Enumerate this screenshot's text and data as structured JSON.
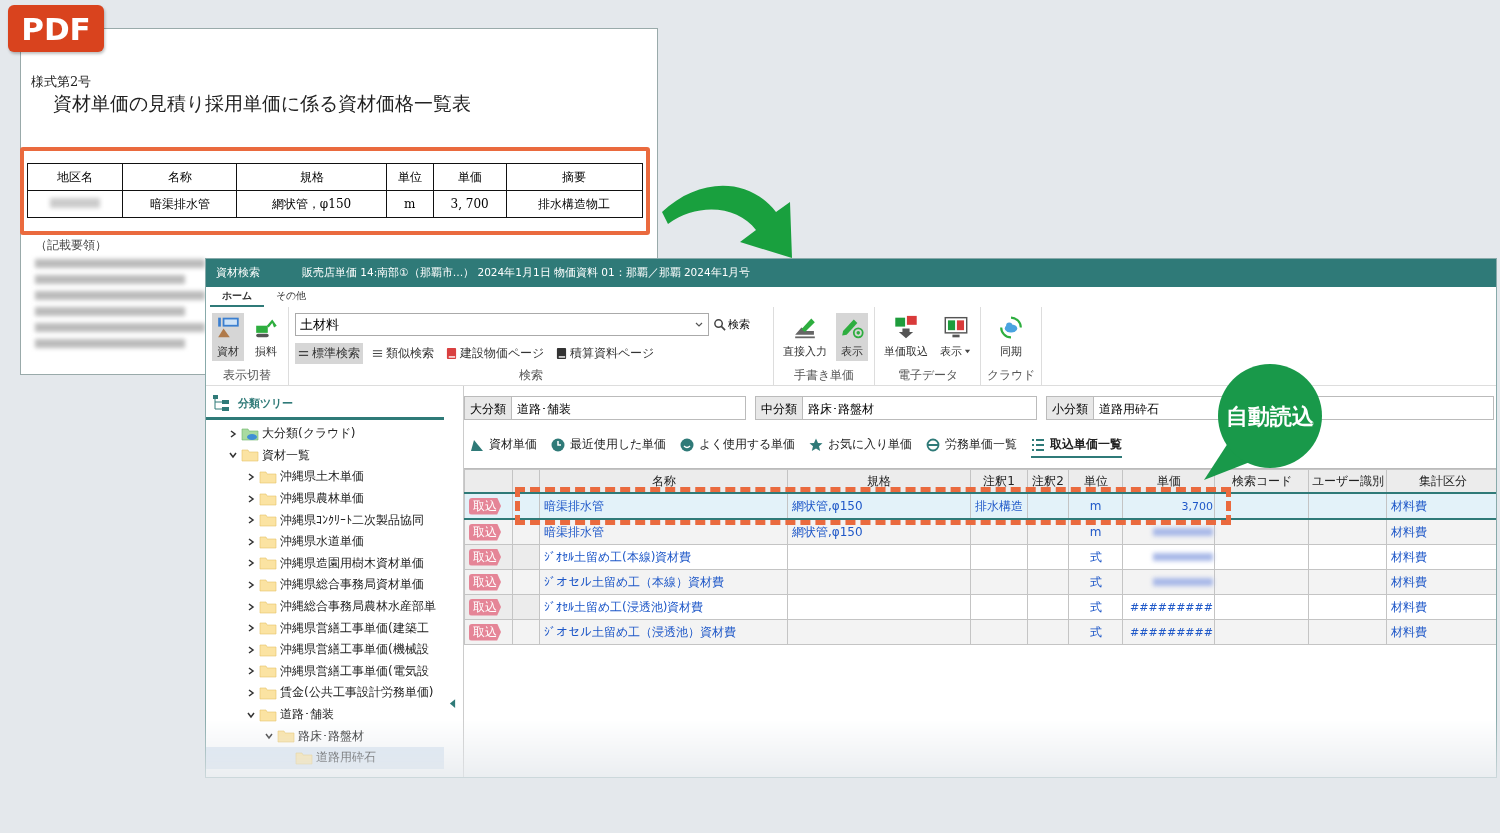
{
  "pdf_badge": "PDF",
  "document": {
    "form_number": "様式第2号",
    "title": "資材単価の見積り採用単価に係る資材価格一覧表",
    "table": {
      "columns": [
        "地区名",
        "名称",
        "規格",
        "単位",
        "単価",
        "摘要"
      ],
      "rows": [
        {
          "name": "暗渠排水管",
          "spec": "網状管，φ150",
          "unit": "m",
          "price": "3, 700",
          "summary": "排水構造物工"
        }
      ]
    },
    "notes_heading": "（記載要領）"
  },
  "app": {
    "title": "資材検索",
    "subtitle": "販売店単価 14:南部①（那覇市…） 2024年1月1日 物価資料 01：那覇／那覇 2024年1月号",
    "tabs": [
      {
        "label": "ホーム",
        "selected": true
      },
      {
        "label": "その他",
        "selected": false
      }
    ],
    "view_group": {
      "label": "表示切替",
      "buttons": [
        {
          "label": "資材",
          "kind": "material",
          "selected": true
        },
        {
          "label": "損料",
          "kind": "excavator",
          "selected": false
        }
      ]
    },
    "search_group": {
      "label": "検索",
      "value": "土材料",
      "button": "検索",
      "options": [
        {
          "label": "標準検索",
          "kind": "equal",
          "selected": true
        },
        {
          "label": "類似検索",
          "kind": "similar",
          "selected": false
        },
        {
          "label": "建設物価ページ",
          "kind": "redbook",
          "selected": false
        },
        {
          "label": "積算資料ページ",
          "kind": "darkbook",
          "selected": false
        }
      ]
    },
    "tool_groups": [
      {
        "label": "手書き単価",
        "buttons": [
          {
            "label": "直接入力",
            "kind": "pen",
            "selected": false,
            "dropdown": false
          },
          {
            "label": "表示",
            "kind": "peneye",
            "selected": true,
            "dropdown": false
          }
        ]
      },
      {
        "label": "電子データ",
        "buttons": [
          {
            "label": "単価取込",
            "kind": "import",
            "selected": false,
            "dropdown": false
          },
          {
            "label": "表示",
            "kind": "monitor",
            "selected": false,
            "dropdown": true
          }
        ]
      },
      {
        "label": "クラウド",
        "buttons": [
          {
            "label": "同期",
            "kind": "sync",
            "selected": false,
            "dropdown": false
          }
        ]
      }
    ],
    "tree": {
      "title": "分類ツリー",
      "items": [
        {
          "label": "大分類(クラウド)",
          "kind": "cloud",
          "expanded": false,
          "selected": false
        },
        {
          "label": "資材一覧",
          "kind": "folder",
          "expanded": true,
          "selected": false,
          "children": [
            {
              "label": "沖縄県土木単価",
              "kind": "folder",
              "expanded": false,
              "selected": false
            },
            {
              "label": "沖縄県農林単価",
              "kind": "folder",
              "expanded": false,
              "selected": false
            },
            {
              "label": "沖縄県ｺﾝｸﾘｰﾄ二次製品協同",
              "kind": "folder",
              "expanded": false,
              "selected": false
            },
            {
              "label": "沖縄県水道単価",
              "kind": "folder",
              "expanded": false,
              "selected": false
            },
            {
              "label": "沖縄県造園用樹木資材単価",
              "kind": "folder",
              "expanded": false,
              "selected": false
            },
            {
              "label": "沖縄県総合事務局資材単価",
              "kind": "folder",
              "expanded": false,
              "selected": false
            },
            {
              "label": "沖縄総合事務局農林水産部単",
              "kind": "folder",
              "expanded": false,
              "selected": false
            },
            {
              "label": "沖縄県営繕工事単価(建築工",
              "kind": "folder",
              "expanded": false,
              "selected": false
            },
            {
              "label": "沖縄県営繕工事単価(機械設",
              "kind": "folder",
              "expanded": false,
              "selected": false
            },
            {
              "label": "沖縄県営繕工事単価(電気設",
              "kind": "folder",
              "expanded": false,
              "selected": false
            },
            {
              "label": "賃金(公共工事設計労務単価)",
              "kind": "folder",
              "expanded": false,
              "selected": false
            },
            {
              "label": "道路･舗装",
              "kind": "folder",
              "expanded": true,
              "selected": false,
              "children": [
                {
                  "label": "路床･路盤材",
                  "kind": "folder",
                  "expanded": true,
                  "selected": false,
                  "children": [
                    {
                      "label": "道路用砕石",
                      "kind": "leaf",
                      "selected": true
                    }
                  ]
                }
              ]
            }
          ]
        }
      ]
    },
    "filters": [
      {
        "label": "大分類",
        "value": "道路･舗装"
      },
      {
        "label": "中分類",
        "value": "路床･路盤材"
      },
      {
        "label": "小分類",
        "value": "道路用砕石"
      }
    ],
    "list_tabs": [
      {
        "label": "資材単価",
        "kind": "material",
        "selected": false
      },
      {
        "label": "最近使用した単価",
        "kind": "clock",
        "selected": false
      },
      {
        "label": "よく使用する単価",
        "kind": "smile",
        "selected": false
      },
      {
        "label": "お気に入り単価",
        "kind": "star",
        "selected": false
      },
      {
        "label": "労務単価一覧",
        "kind": "helmet",
        "selected": false
      },
      {
        "label": "取込単価一覧",
        "kind": "list",
        "selected": true
      }
    ],
    "table": {
      "columns": [
        "名称",
        "規格",
        "注釈1",
        "注釈2",
        "単位",
        "単価",
        "検索コード",
        "ユーザー識別",
        "集計区分"
      ],
      "rows": [
        {
          "button": "取込",
          "name": "暗渠排水管",
          "spec": "網状管,φ150",
          "note1": "排水構造",
          "unit": "m",
          "price": "3,700",
          "price_blurred": false,
          "category": "材料費",
          "selected": true
        },
        {
          "button": "取込",
          "name": "暗渠排水管",
          "spec": "網状管,φ150",
          "unit": "m",
          "price_blurred": true,
          "category": "材料費",
          "selected": false
        },
        {
          "button": "取込",
          "name": "ｼﾞｵｾﾙ土留め工(本線)資材費",
          "unit": "式",
          "price_blurred": true,
          "category": "材料費",
          "selected": false
        },
        {
          "button": "取込",
          "name": "ｼﾞオセル土留め工（本線）資材費",
          "unit": "式",
          "price_blurred": true,
          "category": "材料費",
          "selected": false
        },
        {
          "button": "取込",
          "name": "ｼﾞｵｾﾙ土留め工(浸透池)資材費",
          "unit": "式",
          "price": "#########",
          "price_blurred": false,
          "category": "材料費",
          "selected": false
        },
        {
          "button": "取込",
          "name": "ｼﾞオセル土留め工（浸透池）資材費",
          "unit": "式",
          "price": "#########",
          "price_blurred": false,
          "category": "材料費",
          "selected": false
        }
      ]
    }
  },
  "callout": "自動読込"
}
